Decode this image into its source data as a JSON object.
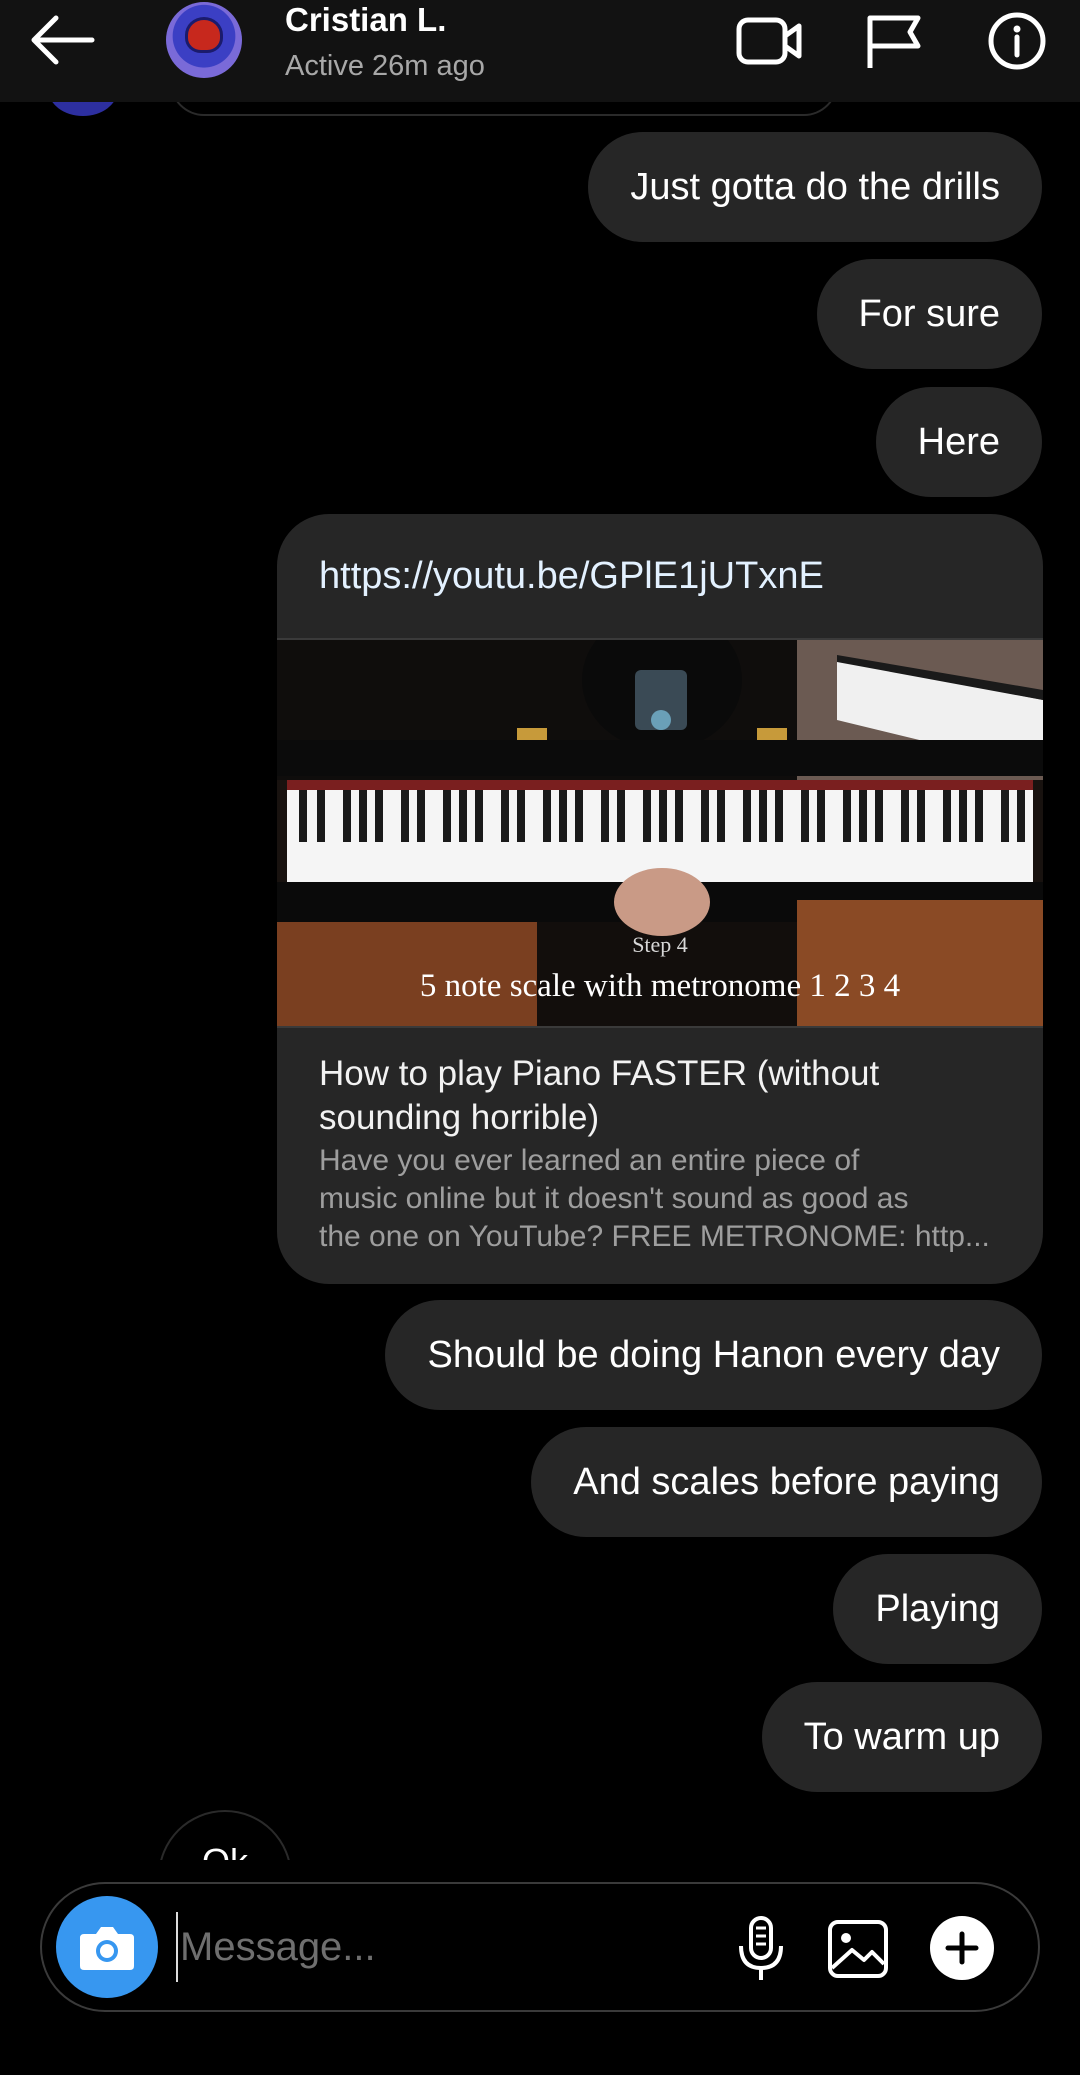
{
  "header": {
    "name": "Cristian L.",
    "status": "Active 26m ago"
  },
  "messages": [
    {
      "text": "Just gotta do the drills"
    },
    {
      "text": "For sure"
    },
    {
      "text": "Here"
    },
    {
      "text": "Should be doing Hanon every day"
    },
    {
      "text": "And scales before paying"
    },
    {
      "text": "Playing"
    },
    {
      "text": "To warm up"
    }
  ],
  "link_preview": {
    "url": "https://youtu.be/GPlE1jUTxnE",
    "thumbnail_step": "Step 4",
    "thumbnail_caption": "5 note scale with metronome 1 2 3 4",
    "title": "How to play Piano FASTER (without sounding horrible)",
    "description_lines": [
      "Have you ever learned an entire piece of",
      "music online but it doesn't sound as good as",
      "the one on YouTube? FREE METRONOME: http..."
    ]
  },
  "received_partial": {
    "text": "Ok"
  },
  "composer": {
    "placeholder": "Message..."
  },
  "colors": {
    "background": "#000000",
    "header_bg": "#121212",
    "bubble": "#262626",
    "camera_button": "#3797f0",
    "secondary_text": "#a8a8a8"
  },
  "icons": [
    "back-arrow-icon",
    "video-call-icon",
    "flag-icon",
    "info-icon",
    "camera-icon",
    "microphone-icon",
    "gallery-icon",
    "plus-icon"
  ]
}
